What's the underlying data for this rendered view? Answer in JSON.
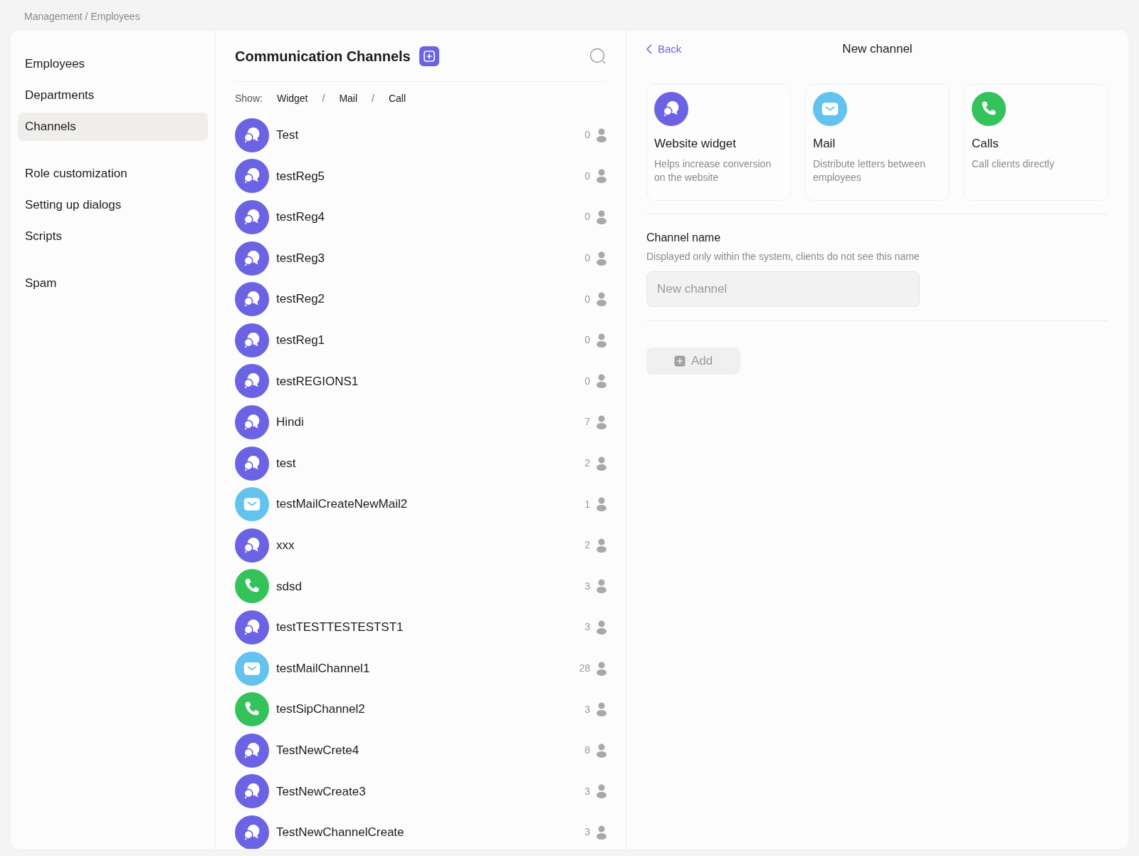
{
  "breadcrumb": "Management / Employees",
  "sidebar": {
    "groups": [
      [
        {
          "label": "Employees",
          "selected": false
        },
        {
          "label": "Departments",
          "selected": false
        },
        {
          "label": "Channels",
          "selected": true
        }
      ],
      [
        {
          "label": "Role customization",
          "selected": false
        },
        {
          "label": "Setting up dialogs",
          "selected": false
        },
        {
          "label": "Scripts",
          "selected": false
        }
      ],
      [
        {
          "label": "Spam",
          "selected": false
        }
      ]
    ]
  },
  "channels_panel": {
    "title": "Communication Channels",
    "show_label": "Show:",
    "filters": [
      "Widget",
      "Mail",
      "Call"
    ],
    "separator": "/",
    "channels": [
      {
        "name": "Test",
        "kind": "widget",
        "count": "0"
      },
      {
        "name": "testReg5",
        "kind": "widget",
        "count": "0"
      },
      {
        "name": "testReg4",
        "kind": "widget",
        "count": "0"
      },
      {
        "name": "testReg3",
        "kind": "widget",
        "count": "0"
      },
      {
        "name": "testReg2",
        "kind": "widget",
        "count": "0"
      },
      {
        "name": "testReg1",
        "kind": "widget",
        "count": "0"
      },
      {
        "name": "testREGIONS1",
        "kind": "widget",
        "count": "0"
      },
      {
        "name": "Hindi",
        "kind": "widget",
        "count": "7"
      },
      {
        "name": "test",
        "kind": "widget",
        "count": "2"
      },
      {
        "name": "testMailCreateNewMail2",
        "kind": "mail",
        "count": "1"
      },
      {
        "name": "xxx",
        "kind": "widget",
        "count": "2"
      },
      {
        "name": "sdsd",
        "kind": "call",
        "count": "3"
      },
      {
        "name": "testTESTTESTESTST1",
        "kind": "widget",
        "count": "3"
      },
      {
        "name": "testMailChannel1",
        "kind": "mail",
        "count": "28"
      },
      {
        "name": "testSipChannel2",
        "kind": "call",
        "count": "3"
      },
      {
        "name": "TestNewCrete4",
        "kind": "widget",
        "count": "8"
      },
      {
        "name": "TestNewCreate3",
        "kind": "widget",
        "count": "3"
      },
      {
        "name": "TestNewChannelCreate",
        "kind": "widget",
        "count": "3"
      }
    ]
  },
  "new_channel": {
    "back": "Back",
    "title": "New channel",
    "types": [
      {
        "kind": "widget",
        "title": "Website widget",
        "description": "Helps increase conversion on the website"
      },
      {
        "kind": "mail",
        "title": "Mail",
        "description": "Distribute letters between employees"
      },
      {
        "kind": "call",
        "title": "Calls",
        "description": "Call clients directly"
      }
    ],
    "name_label": "Channel name",
    "name_hint": "Displayed only within the system, clients do not see this name",
    "name_field": {
      "placeholder": "New channel"
    },
    "add_button": {
      "label": "Add",
      "disabled": true
    }
  }
}
